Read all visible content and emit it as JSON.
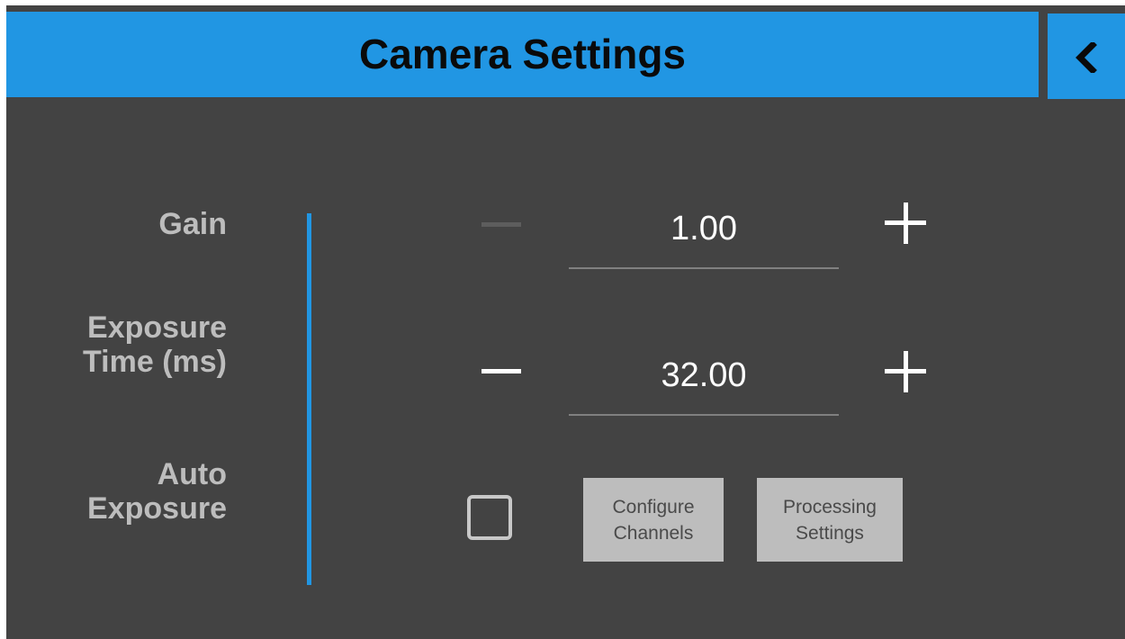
{
  "header": {
    "title": "Camera Settings",
    "back_icon": "chevron-left-icon"
  },
  "colors": {
    "accent": "#2196e3",
    "background": "#434343",
    "label": "#bdbdbd",
    "value": "#ffffff",
    "button_bg": "#bdbdbd"
  },
  "gain": {
    "label": "Gain",
    "value": "1.00",
    "decrement_enabled": false
  },
  "exposure_time": {
    "label_line1": "Exposure",
    "label_line2": "Time (ms)",
    "value": "32.00",
    "decrement_enabled": true
  },
  "auto_exposure": {
    "label_line1": "Auto",
    "label_line2": "Exposure",
    "checked": false
  },
  "buttons": {
    "configure_channels_line1": "Configure",
    "configure_channels_line2": "Channels",
    "processing_settings_line1": "Processing",
    "processing_settings_line2": "Settings"
  }
}
